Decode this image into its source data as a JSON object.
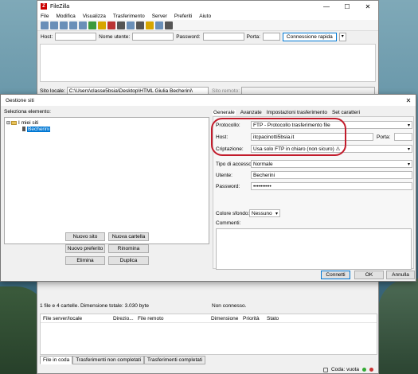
{
  "app": {
    "title": "FileZilla",
    "logo": "Z",
    "min": "—",
    "max": "☐",
    "close": "✕"
  },
  "menu": [
    "File",
    "Modifica",
    "Visualizza",
    "Trasferimento",
    "Server",
    "Preferiti",
    "Aiuto"
  ],
  "quickconnect": {
    "host": "Host:",
    "user": "Nome utente:",
    "password": "Password:",
    "port": "Porta:",
    "button": "Connessione rapida",
    "drop": "▾"
  },
  "paths": {
    "local_label": "Sito locale:",
    "local_value": "C:\\Users\\classe5bsia\\Desktop\\HTML Giulia Becherini\\",
    "remote_label": "Sito remoto:"
  },
  "status": {
    "local": "1 file e 4 cartelle. Dimensione totale: 3.030 byte",
    "remote": "Non connesso."
  },
  "queue": {
    "headers": [
      "File server/locale",
      "Direzio...",
      "File remoto",
      "Dimensione",
      "Priorità",
      "Stato"
    ],
    "tabs": [
      "File in coda",
      "Trasferimenti non completati",
      "Trasferimenti completati"
    ],
    "status": "Coda: vuota"
  },
  "dialog": {
    "title": "Gestione siti",
    "close": "✕",
    "select_label": "Seleziona elemento:",
    "tree": {
      "root": "I miei siti",
      "child": "Becherini"
    },
    "buttons": {
      "new_site": "Nuovo sito",
      "new_folder": "Nuova cartella",
      "new_bookmark": "Nuovo preferito",
      "rename": "Rinomina",
      "delete": "Elimina",
      "duplicate": "Duplica"
    },
    "tabs": [
      "Generale",
      "Avanzate",
      "Impostazioni trasferimento",
      "Set caratteri"
    ],
    "fields": {
      "protocol_label": "Protocollo:",
      "protocol_value": "FTP - Protocollo trasferimento file",
      "host_label": "Host:",
      "host_value": "itcpacinotti5bsia.it",
      "port_label": "Porta:",
      "encryption_label": "Criptazione:",
      "encryption_value": "Usa solo FTP in chiaro (non sicuro) ⚠",
      "logon_label": "Tipo di accesso:",
      "logon_value": "Normale",
      "user_label": "Utente:",
      "user_value": "Becherini",
      "password_label": "Password:",
      "password_value": "••••••••••",
      "bg_label": "Colore sfondo:",
      "bg_value": "Nessuno",
      "comments_label": "Commenti:"
    },
    "footer": {
      "connect": "Connetti",
      "ok": "OK",
      "cancel": "Annulla"
    }
  },
  "colors": {
    "accent": "#0078d4",
    "highlight": "#c21b2b"
  }
}
